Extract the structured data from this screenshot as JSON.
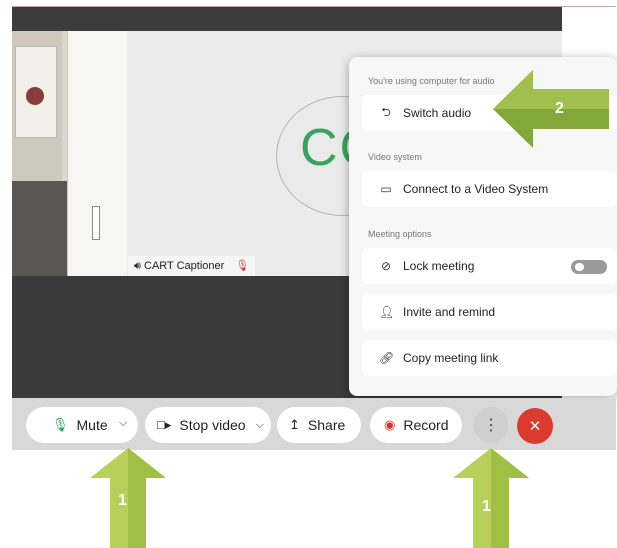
{
  "colors": {
    "arrow": "#83a83a",
    "arrow_light": "#b6d05a",
    "end_call": "#dc3a2e",
    "avatar_text": "#3aa35f"
  },
  "stage": {
    "avatar_initials": "CC",
    "participant_name": "CART Captioner"
  },
  "menu": {
    "audio_section_label": "You're using computer for audio",
    "switch_audio": "Switch audio",
    "video_section_label": "Video system",
    "connect_video": "Connect to a Video System",
    "meeting_section_label": "Meeting options",
    "lock_meeting": "Lock meeting",
    "lock_meeting_enabled": false,
    "invite": "Invite and remind",
    "copy_link": "Copy meeting link"
  },
  "toolbar": {
    "mute": "Mute",
    "stop_video": "Stop video",
    "share": "Share",
    "record": "Record"
  },
  "icons": {
    "mic": "microphone-icon",
    "chevron": "chevron-down-icon",
    "video": "video-camera-icon",
    "share": "share-icon",
    "record": "record-icon",
    "more": "more-options-icon",
    "end": "close-icon",
    "switch_audio": "switch-audio-icon",
    "video_system": "video-system-icon",
    "lock": "lock-icon",
    "invite": "person-add-icon",
    "link": "link-icon"
  },
  "annotations": {
    "arrow_mute_number": "1",
    "arrow_more_number": "1",
    "arrow_switch_number": "2"
  }
}
